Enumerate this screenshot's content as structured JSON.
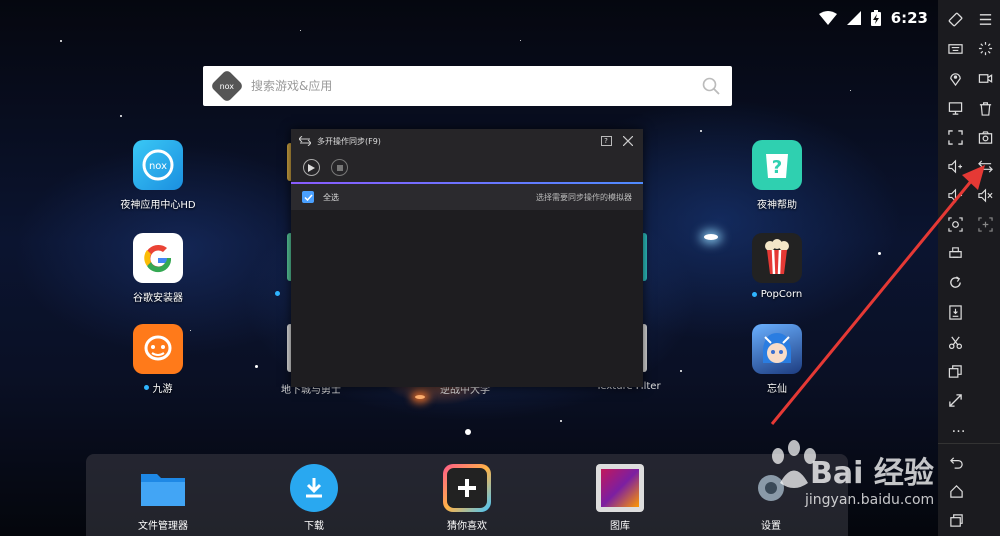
{
  "status_bar": {
    "time": "6:23"
  },
  "search": {
    "logo_text": "nox",
    "placeholder": "搜索游戏&应用"
  },
  "apps": {
    "left": [
      {
        "label": "夜神应用中心HD"
      },
      {
        "label": "谷歌安装器"
      },
      {
        "label": "九游"
      }
    ],
    "right": [
      {
        "label": "夜神帮助"
      },
      {
        "label": "PopCorn"
      },
      {
        "label": "忘仙"
      }
    ],
    "partial": [
      {
        "label": "地下城与勇士"
      },
      {
        "label": "逆战中大学"
      },
      {
        "label": "Texture Filter"
      }
    ]
  },
  "dialog": {
    "title": "多开操作同步(F9)",
    "help": "?",
    "select_all": "全选",
    "hint": "选择需要同步操作的模拟器"
  },
  "dock": [
    {
      "label": "文件管理器"
    },
    {
      "label": "下载"
    },
    {
      "label": "猜你喜欢"
    },
    {
      "label": "图库"
    },
    {
      "label": "设置"
    }
  ],
  "sidebar": {
    "more": "…"
  },
  "watermark": {
    "brand": "Bai  经验",
    "url": "jingyan.baidu.com"
  },
  "colors": {
    "accent": "#4aa0ff",
    "sidebar_bg": "#1b1b1f",
    "dialog_bg": "#262528",
    "arrow": "#e53935"
  }
}
